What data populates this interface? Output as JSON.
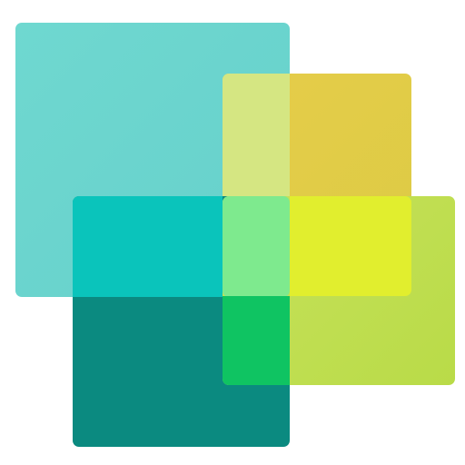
{
  "logo": {
    "name": "overlapping-squares-logo",
    "colors": {
      "teal": "#6fd8d0",
      "gold": "#e6cc4a",
      "dark_teal": "#0b8a80",
      "lime": "#c7e25b",
      "pale_yellow_overlap": "#d5e682",
      "cyan_overlap": "#0ac4bb",
      "mint_overlap": "#7eea8e",
      "bright_yellow_overlap": "#e1ee2e",
      "green_overlap": "#0fc462"
    }
  }
}
